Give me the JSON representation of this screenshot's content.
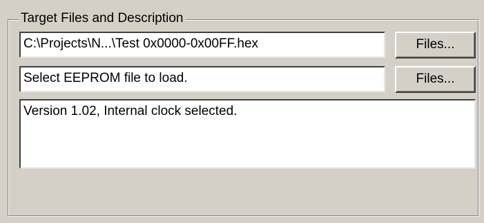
{
  "group": {
    "title": "Target Files and Description"
  },
  "flash_file": {
    "value": "C:\\Projects\\N...\\Test 0x0000-0x00FF.hex",
    "button_label": "Files..."
  },
  "eeprom_file": {
    "value": "Select EEPROM file to load.",
    "button_label": "Files..."
  },
  "description": {
    "value": "Version 1.02, Internal clock selected."
  }
}
